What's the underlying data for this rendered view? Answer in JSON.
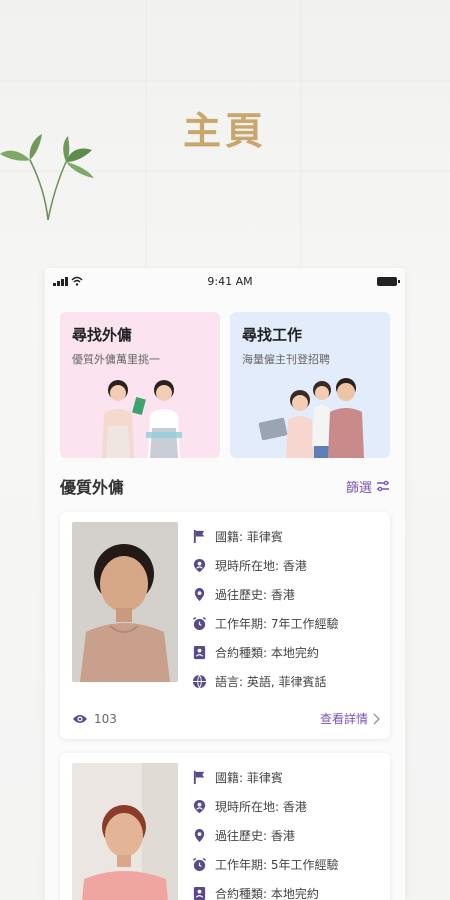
{
  "hero": {
    "title": "主頁"
  },
  "status_bar": {
    "time": "9:41 AM"
  },
  "banners": [
    {
      "title": "尋找外傭",
      "subtitle": "優質外傭萬里挑一"
    },
    {
      "title": "尋找工作",
      "subtitle": "海量僱主刊登招聘"
    }
  ],
  "section": {
    "title": "優質外傭",
    "filter_label": "篩選"
  },
  "cards": [
    {
      "nationality": "國籍: 菲律賓",
      "location": "現時所在地: 香港",
      "history": "過往歷史: 香港",
      "experience": "工作年期: 7年工作經驗",
      "contract": "合約種類: 本地完約",
      "language": "語言: 英語, 菲律賓話",
      "views": "103",
      "details_label": "查看詳情"
    },
    {
      "nationality": "國籍: 菲律賓",
      "location": "現時所在地: 香港",
      "history": "過往歷史: 香港",
      "experience": "工作年期: 5年工作經驗",
      "contract": "合約種類: 本地完約"
    }
  ],
  "colors": {
    "accent": "#7a55b8",
    "hero_gold": "#c9a66b",
    "icon": "#5a4a8a"
  }
}
